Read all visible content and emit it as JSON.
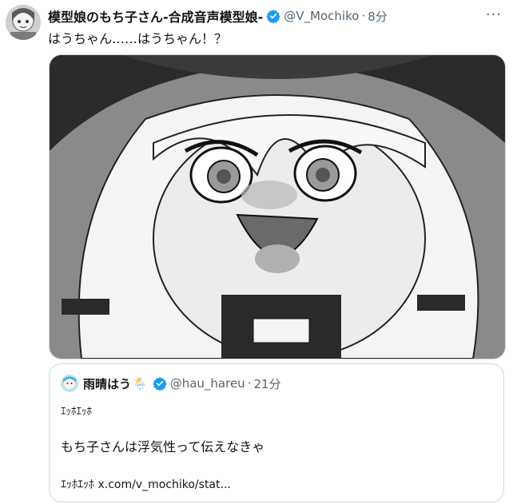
{
  "tweet": {
    "display_name": "模型娘のもち子さん-合成音声模型娘-",
    "handle": "@V_Mochiko",
    "separator": "·",
    "time": "8分",
    "text": "はうちゃん……はうちゃん！？",
    "more_icon": "more-icon"
  },
  "quote": {
    "display_name": "雨晴はう",
    "weather_emoji": "🌦️",
    "handle": "@hau_hareu",
    "separator": "·",
    "time": "21分",
    "line1": "ｴｯﾎｴｯﾎ",
    "line2": "もち子さんは浮気性って伝えなきゃ",
    "line3_prefix": "ｴｯﾎｴｯﾎ",
    "line3_link": "x.com/v_mochiko/stat..."
  },
  "colors": {
    "verified": "#1d9bf0",
    "secondary_text": "#536471",
    "border": "#cfd9de"
  }
}
